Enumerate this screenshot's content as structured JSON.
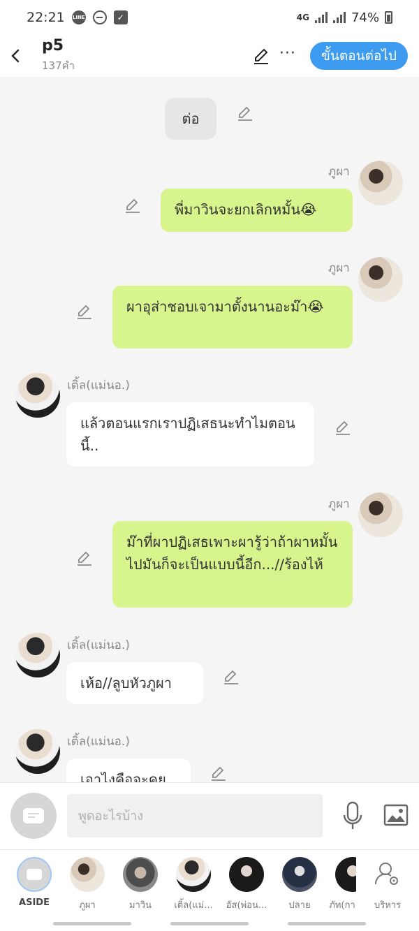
{
  "status": {
    "time": "22:21",
    "network": "4G",
    "battery": "74%"
  },
  "header": {
    "title": "p5",
    "subtitle": "137คำ",
    "next_label": "ขั้นตอนต่อไป"
  },
  "messages": [
    {
      "type": "narration",
      "text": "ต่อ"
    },
    {
      "type": "outgoing",
      "sender": "ภูผา",
      "text": "พี่มาวินจะยกเลิกหมั้น😭"
    },
    {
      "type": "outgoing",
      "sender": "ภูผา",
      "text": "ผาอุส่าชอบเจามาตั้งนานอะม๊า😭"
    },
    {
      "type": "incoming",
      "sender": "เติ้ล(แม่นอ.)",
      "text": "แล้วตอนแรกเราปฏิเสธนะทำไมตอนนี้.."
    },
    {
      "type": "outgoing",
      "sender": "ภูผา",
      "text": "ม๊าที่ผาปฏิเสธเพาะผารู้ว่าถ้าผาหมั้นไปมันก็จะเป็นแบบนี้อีก...//ร้องไห้"
    },
    {
      "type": "incoming",
      "sender": "เติ้ล(แม่นอ.)",
      "text": "เห้อ//ลูบหัวภูผา"
    },
    {
      "type": "incoming",
      "sender": "เติ้ล(แม่นอ.)",
      "text": "เอาไงคือจะคุย"
    }
  ],
  "input": {
    "placeholder": "พูดอะไรบ้าง"
  },
  "characters": [
    {
      "label": "ASIDE"
    },
    {
      "label": "ภูผา"
    },
    {
      "label": "มาวิน"
    },
    {
      "label": "เติ้ล(แม่..."
    },
    {
      "label": "อัส(พ่อน..."
    },
    {
      "label": "ปลาย"
    },
    {
      "label": "ภัท(กา"
    },
    {
      "label": "บริหาร"
    }
  ],
  "colors": {
    "accent": "#3d9bf0",
    "bubble_outgoing": "#d7f58c",
    "bubble_incoming": "#ffffff",
    "background": "#f5f5f5"
  }
}
